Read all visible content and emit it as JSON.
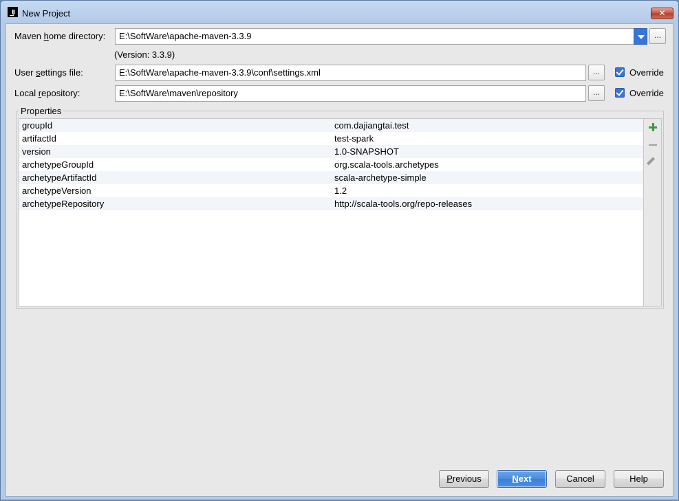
{
  "window": {
    "title": "New Project",
    "close_glyph": "✕"
  },
  "maven_home": {
    "label_pre": "Maven ",
    "label_mnemonic": "h",
    "label_post": "ome directory:",
    "value": "E:\\SoftWare\\apache-maven-3.3.9",
    "version_note": "(Version: 3.3.9)"
  },
  "user_settings": {
    "label_pre": "User ",
    "label_mnemonic": "s",
    "label_post": "ettings file:",
    "value": "E:\\SoftWare\\apache-maven-3.3.9\\conf\\settings.xml",
    "override_label": "Override",
    "override_checked": true
  },
  "local_repo": {
    "label_pre": "Local ",
    "label_mnemonic": "r",
    "label_post": "epository:",
    "value": "E:\\SoftWare\\maven\\repository",
    "override_label": "Override",
    "override_checked": true
  },
  "browse_glyph": "...",
  "properties": {
    "title": "Properties",
    "rows": [
      {
        "key": "groupId",
        "value": "com.dajiangtai.test"
      },
      {
        "key": "artifactId",
        "value": "test-spark"
      },
      {
        "key": "version",
        "value": "1.0-SNAPSHOT"
      },
      {
        "key": "archetypeGroupId",
        "value": "org.scala-tools.archetypes"
      },
      {
        "key": "archetypeArtifactId",
        "value": "scala-archetype-simple"
      },
      {
        "key": "archetypeVersion",
        "value": "1.2"
      },
      {
        "key": "archetypeRepository",
        "value": "http://scala-tools.org/repo-releases"
      }
    ]
  },
  "buttons": {
    "previous_mnemonic": "P",
    "previous_rest": "revious",
    "next_mnemonic": "N",
    "next_rest": "ext",
    "cancel": "Cancel",
    "help": "Help"
  },
  "colors": {
    "accent": "#3875d7",
    "add": "#3a9a3a"
  }
}
